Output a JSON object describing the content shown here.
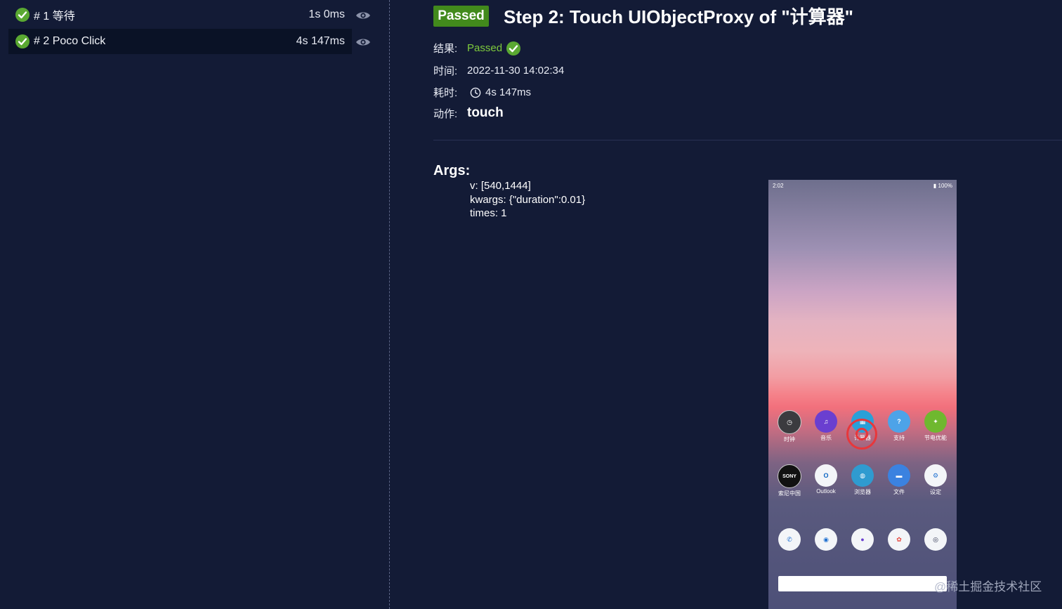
{
  "steps": [
    {
      "label": "# 1 等待",
      "duration": "1s 0ms",
      "status": "passed"
    },
    {
      "label": "# 2 Poco Click",
      "duration": "4s 147ms",
      "status": "passed",
      "active": true
    }
  ],
  "detail": {
    "badge": "Passed",
    "title": "Step 2: Touch UIObjectProxy of \"计算器\"",
    "result_label": "结果:",
    "result_value": "Passed",
    "time_label": "时间:",
    "time_value": "2022-11-30 14:02:34",
    "duration_label": "耗时:",
    "duration_value": "4s 147ms",
    "action_label": "动作:",
    "action_value": "touch",
    "args_title": "Args:",
    "args": [
      "v: [540,1444]",
      "kwargs: {\"duration\":0.01}",
      "times: 1"
    ]
  },
  "phone": {
    "status_time": "2:02",
    "status_battery": "100%",
    "apps_row1": [
      {
        "label": "时钟",
        "icon": "clock-icon",
        "color": "#3b3b3f"
      },
      {
        "label": "音乐",
        "icon": "music-icon",
        "color": "#6a3fd0"
      },
      {
        "label": "计算器",
        "icon": "calculator-icon",
        "color": "#2aa0d8"
      },
      {
        "label": "支持",
        "icon": "help-icon",
        "color": "#4da3e8"
      },
      {
        "label": "节电优能",
        "icon": "battery-saver-icon",
        "color": "#6fb82f"
      }
    ],
    "apps_row2": [
      {
        "label": "索尼中国",
        "icon": "sony-icon",
        "color": "#111111",
        "text": "SONY"
      },
      {
        "label": "Outlook",
        "icon": "outlook-icon",
        "color": "#f3f5f8"
      },
      {
        "label": "浏览器",
        "icon": "browser-icon",
        "color": "#2f9bd0"
      },
      {
        "label": "文件",
        "icon": "files-icon",
        "color": "#3b82e0"
      },
      {
        "label": "设定",
        "icon": "settings-icon",
        "color": "#f3f5f8"
      }
    ],
    "dock": [
      {
        "icon": "phone-icon",
        "color": "#f3f5f8"
      },
      {
        "icon": "messages-icon",
        "color": "#f3f5f8"
      },
      {
        "icon": "contacts-icon",
        "color": "#f3f5f8"
      },
      {
        "icon": "photos-icon",
        "color": "#f3f5f8"
      },
      {
        "icon": "camera-icon",
        "color": "#f3f5f8"
      }
    ]
  },
  "watermark": "@稀土掘金技术社区",
  "colors": {
    "background": "#131b36",
    "badge": "#428a1c",
    "passed_text": "#7ecb3c",
    "touch_marker": "#e8373b"
  }
}
